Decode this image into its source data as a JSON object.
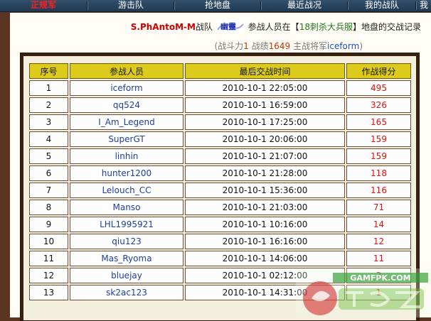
{
  "nav": {
    "tabs": [
      {
        "label": "正规军",
        "active": true
      },
      {
        "label": "游击队",
        "active": false
      },
      {
        "label": "抢地盘",
        "active": false
      },
      {
        "label": "最近战况",
        "active": false
      },
      {
        "label": "我的战队",
        "active": false
      },
      {
        "label": "我",
        "active": false
      }
    ]
  },
  "header": {
    "team_name": "S.PhAntoM-M",
    "team_suffix": "战队",
    "logo_text": "幽靈",
    "participants_in": "参战人员在",
    "bracket_open": "【",
    "server_name": "18刺杀大兵服",
    "bracket_close": "】",
    "record_title": "地盘的交战记录"
  },
  "summary": {
    "open": "(战斗力",
    "combat_power": "1",
    "record_label": " 战绩",
    "record": "1649",
    "commander_label": " 主战将军",
    "commander": "iceform",
    "close": ")"
  },
  "table": {
    "headers": [
      "序号",
      "参战人员",
      "最后交战时间",
      "作战得分"
    ],
    "rows": [
      {
        "idx": "1",
        "player": "iceform",
        "time": "2010-10-1 22:05:00",
        "score": "495"
      },
      {
        "idx": "2",
        "player": "qq524",
        "time": "2010-10-1 16:59:00",
        "score": "326"
      },
      {
        "idx": "3",
        "player": "I_Am_Legend",
        "time": "2010-10-1 17:25:00",
        "score": "165"
      },
      {
        "idx": "4",
        "player": "SuperGT",
        "time": "2010-10-1 20:06:00",
        "score": "159"
      },
      {
        "idx": "5",
        "player": "linhin",
        "time": "2010-10-1 21:07:00",
        "score": "159"
      },
      {
        "idx": "6",
        "player": "hunter1200",
        "time": "2010-10-1 21:28:00",
        "score": "118"
      },
      {
        "idx": "7",
        "player": "Lelouch_CC",
        "time": "2010-10-1 15:36:00",
        "score": "116"
      },
      {
        "idx": "8",
        "player": "Manso",
        "time": "2010-10-1 21:03:00",
        "score": "71"
      },
      {
        "idx": "9",
        "player": "LHL1995921",
        "time": "2010-10-1 10:16:00",
        "score": "14"
      },
      {
        "idx": "10",
        "player": "qiu123",
        "time": "2010-10-1 16:16:00",
        "score": "12"
      },
      {
        "idx": "11",
        "player": "Mas_Ryoma",
        "time": "2010-10-1 14:06:00",
        "score": "11"
      },
      {
        "idx": "12",
        "player": "bluejay",
        "time": "2010-10-1 02:12:00",
        "score": "2"
      },
      {
        "idx": "13",
        "player": "sk2ac123",
        "time": "2010-10-1 14:31:00",
        "score": "1"
      }
    ]
  },
  "watermark": {
    "text": "GAMFPK.COM"
  },
  "colors": {
    "nav_bg": "#2a4660",
    "active_tab": "#ff1e1e",
    "header_yellow": "#dccb1a",
    "score_red": "#dd1111",
    "player_blue": "#1f3f9f",
    "frame_brown": "#3a200f"
  }
}
